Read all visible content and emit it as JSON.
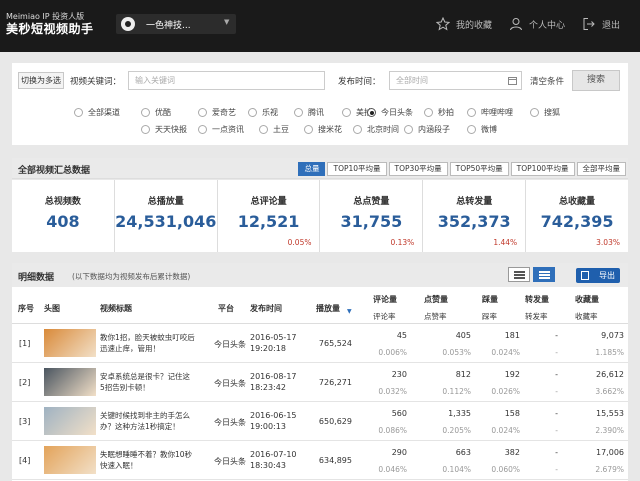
{
  "topbar": {
    "brand_sub": "Meimiao IP 投资人版",
    "brand_main": "美秒短视频助手",
    "account_name": "一色神技...",
    "nav": [
      {
        "label": "我的收藏",
        "icon": "star-icon"
      },
      {
        "label": "个人中心",
        "icon": "user-icon"
      },
      {
        "label": "退出",
        "icon": "logout-icon"
      }
    ]
  },
  "search": {
    "toggle_label": "切换为多选",
    "keyword_label": "视频关键词：",
    "keyword_placeholder": "输入关键词",
    "time_label": "发布时间：",
    "time_placeholder": "全部时间",
    "clear_label": "清空条件",
    "search_label": "搜索",
    "platforms_row1": [
      "全部渠道",
      "优酷",
      "爱奇艺",
      "乐视",
      "腾讯",
      "美拍",
      "今日头条",
      "秒拍",
      "哔哩哔哩",
      "搜狐"
    ],
    "platforms_row2": [
      "天天快报",
      "一点资讯",
      "土豆",
      "搜米花",
      "北京时间",
      "内涵段子",
      "微博"
    ],
    "selected": "今日头条"
  },
  "summary": {
    "title": "全部视频汇总数据",
    "tabs": [
      "总量",
      "TOP10平均量",
      "TOP30平均量",
      "TOP50平均量",
      "TOP100平均量",
      "全部平均量"
    ],
    "active_tab": "总量",
    "cards": [
      {
        "label": "总视频数",
        "value": "408",
        "pct": ""
      },
      {
        "label": "总播放量",
        "value": "24,531,046",
        "pct": ""
      },
      {
        "label": "总评论量",
        "value": "12,521",
        "pct": "0.05%"
      },
      {
        "label": "总点赞量",
        "value": "31,755",
        "pct": "0.13%"
      },
      {
        "label": "总转发量",
        "value": "352,373",
        "pct": "1.44%"
      },
      {
        "label": "总收藏量",
        "value": "742,395",
        "pct": "3.03%"
      }
    ]
  },
  "detail": {
    "title": "明细数据",
    "note": "(以下数据均为视频发布后累计数据)",
    "export_label": "导出",
    "headers": {
      "index": "序号",
      "thumb": "头图",
      "title": "视频标题",
      "platform": "平台",
      "time": "发布时间",
      "plays": "播放量",
      "comments": "评论量",
      "likes": "点赞量",
      "danmu": "踩量",
      "shares": "转发量",
      "favs": "收藏量",
      "comment_rate": "评论率",
      "like_rate": "点赞率",
      "danmu_rate": "踩率",
      "share_rate": "转发率",
      "fav_rate": "收藏率"
    },
    "rows": [
      {
        "idx": "[1]",
        "title1": "教你1招，脸天被蚊虫叮咬后",
        "title2": "迅速止痒，管用！",
        "platform": "今日头条",
        "date": "2016-05-17",
        "time": "19:20:18",
        "plays": "765,524",
        "comments": "45",
        "comments_r": "0.006%",
        "likes": "405",
        "likes_r": "0.053%",
        "danmu": "181",
        "danmu_r": "0.024%",
        "shares": "-",
        "shares_r": "-",
        "favs": "9,073",
        "favs_r": "1.185%",
        "thumb_color": "#d98a3a"
      },
      {
        "idx": "[2]",
        "title1": "安卓系统总是很卡？记住这",
        "title2": "5招告别卡顿！",
        "platform": "今日头条",
        "date": "2016-08-17",
        "time": "18:23:42",
        "plays": "726,271",
        "comments": "230",
        "comments_r": "0.032%",
        "likes": "812",
        "likes_r": "0.112%",
        "danmu": "192",
        "danmu_r": "0.026%",
        "shares": "-",
        "shares_r": "-",
        "favs": "26,612",
        "favs_r": "3.662%",
        "thumb_color": "#4a5560"
      },
      {
        "idx": "[3]",
        "title1": "关键时候找到非主的手怎么",
        "title2": "办？这种方法1秒搞定！",
        "platform": "今日头条",
        "date": "2016-06-15",
        "time": "19:00:13",
        "plays": "650,629",
        "comments": "560",
        "comments_r": "0.086%",
        "likes": "1,335",
        "likes_r": "0.205%",
        "danmu": "158",
        "danmu_r": "0.024%",
        "shares": "-",
        "shares_r": "-",
        "favs": "15,553",
        "favs_r": "2.390%",
        "thumb_color": "#9fb2c2"
      },
      {
        "idx": "[4]",
        "title1": "失眠想睡睡不着？教你10秒",
        "title2": "快速入眠！",
        "platform": "今日头条",
        "date": "2016-07-10",
        "time": "18:30:43",
        "plays": "634,895",
        "comments": "290",
        "comments_r": "0.046%",
        "likes": "663",
        "likes_r": "0.104%",
        "danmu": "382",
        "danmu_r": "0.060%",
        "shares": "-",
        "shares_r": "-",
        "favs": "17,006",
        "favs_r": "2.679%",
        "thumb_color": "#e3a35a"
      }
    ]
  }
}
